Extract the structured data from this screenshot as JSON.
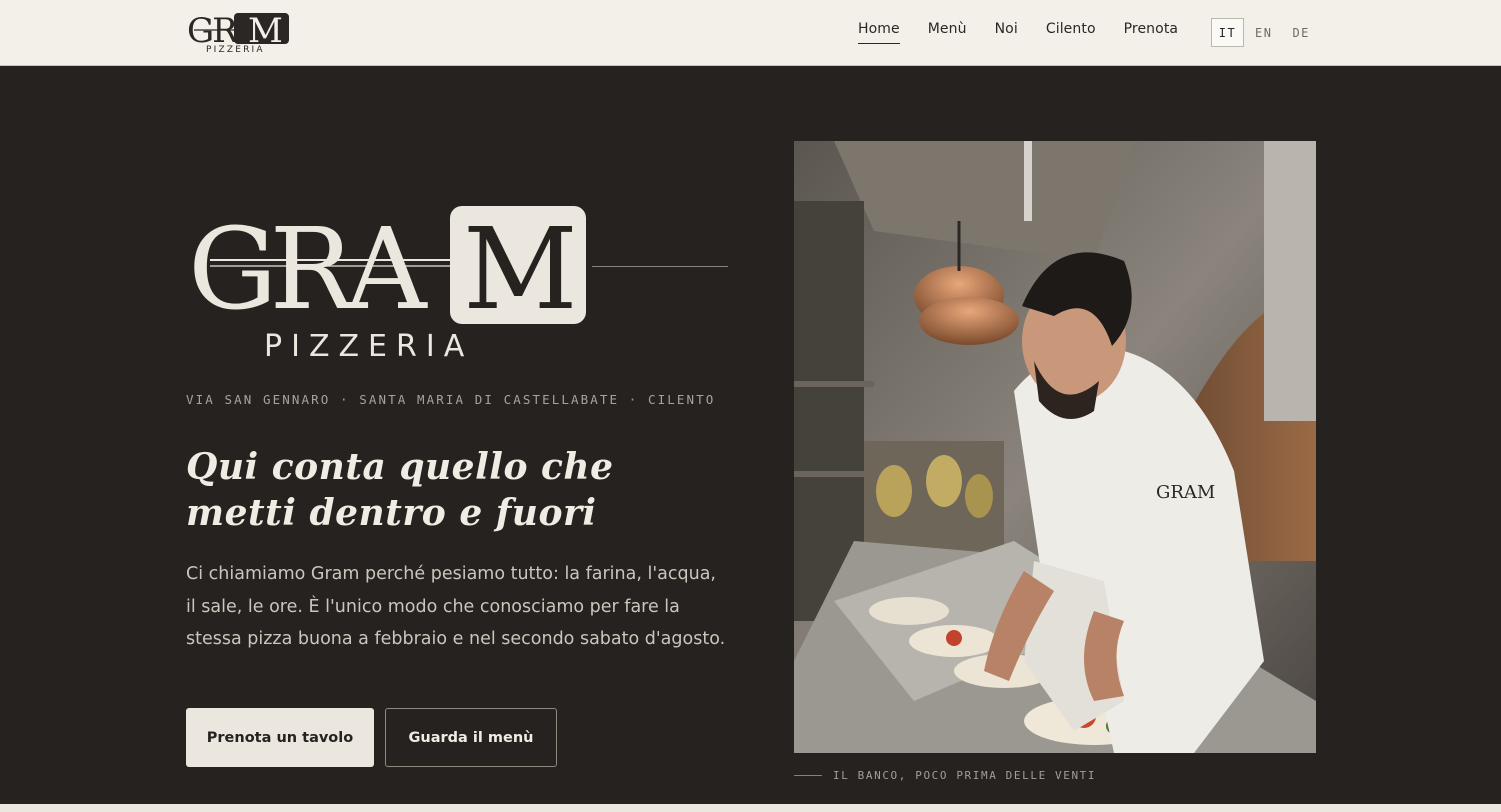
{
  "brand": {
    "wordmark": "GRAM",
    "sub": "PIZZERIA"
  },
  "nav": {
    "items": [
      {
        "label": "Home"
      },
      {
        "label": "Menù"
      },
      {
        "label": "Noi"
      },
      {
        "label": "Cilento"
      },
      {
        "label": "Prenota"
      }
    ],
    "languages": [
      "IT",
      "EN",
      "DE"
    ],
    "active_language": "IT"
  },
  "hero": {
    "address": "VIA SAN GENNARO · SANTA MARIA DI CASTELLABATE · CILENTO",
    "headline_line1": "Qui conta quello che",
    "headline_line2": "metti dentro e fuori",
    "body": "Ci chiamiamo Gram perché pesiamo tutto: la farina, l'acqua, il sale, le ore. È l'unico modo che conosciamo per fare la stessa pizza buona a febbraio e nel secondo sabato d'agosto.",
    "primary_button": "Prenota un tavolo",
    "secondary_button": "Guarda il menù"
  },
  "photo": {
    "caption": "IL BANCO, POCO PRIMA DELLE VENTI"
  },
  "colors": {
    "background": "#252220",
    "header": "#f3f0ea",
    "cream": "#ebe7de",
    "accent": "#b2763f"
  }
}
